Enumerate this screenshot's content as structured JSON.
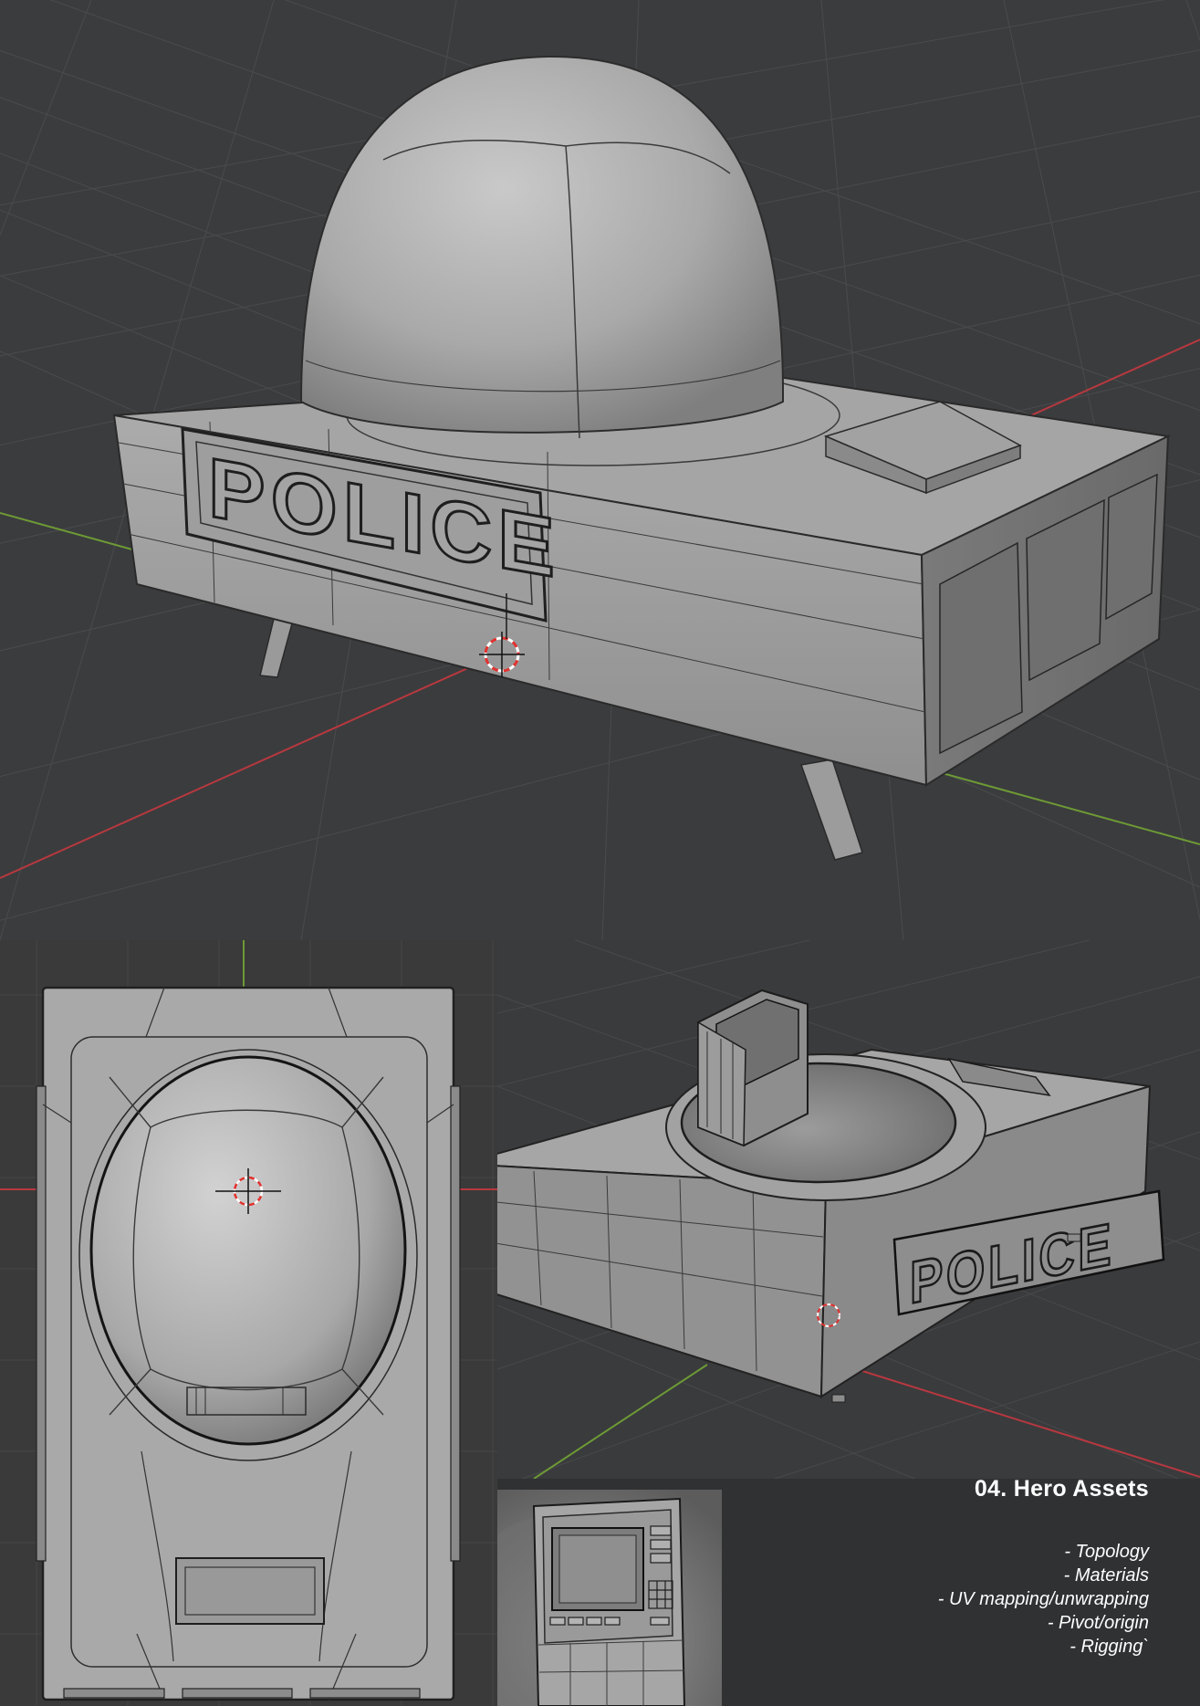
{
  "asset": {
    "label_text": "POLICE"
  },
  "caption": {
    "title": "04. Hero Assets",
    "items": [
      "- Topology",
      "- Materials",
      "- UV mapping/unwrapping",
      "- Pivot/origin",
      "- Rigging`"
    ]
  },
  "colors": {
    "background": "#303133",
    "viewport_bg": "#3b3c3e",
    "grid_line": "#4b4c4e",
    "x_axis": "#b8383f",
    "y_axis": "#6d9a35",
    "mesh_light": "#b8b8b8",
    "mesh_mid": "#999999",
    "mesh_dark": "#6e6e6e",
    "wire": "#2a2a2a",
    "cursor_red": "#e2312f",
    "caption_text": "#ffffff"
  }
}
